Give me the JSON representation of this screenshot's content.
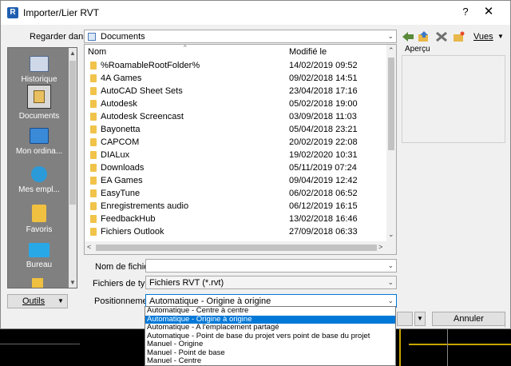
{
  "window": {
    "title": "Importer/Lier RVT",
    "help": "?",
    "close": "✕",
    "app_icon_letter": "R"
  },
  "look_in": {
    "label": "Regarder dans:",
    "value": "Documents"
  },
  "toolbar": {
    "views_label": "Vues"
  },
  "places": [
    {
      "label": "Historique",
      "icon": "history-icon"
    },
    {
      "label": "Documents",
      "icon": "documents-icon"
    },
    {
      "label": "Mon ordina...",
      "icon": "computer-icon"
    },
    {
      "label": "Mes empl...",
      "icon": "network-icon"
    },
    {
      "label": "Favoris",
      "icon": "favorites-icon"
    },
    {
      "label": "Bureau",
      "icon": "desktop-icon"
    }
  ],
  "file_list": {
    "col_name": "Nom",
    "col_modified": "Modifié le",
    "rows": [
      {
        "name": "%RoamableRootFolder%",
        "date": "14/02/2019 09:52"
      },
      {
        "name": "4A Games",
        "date": "09/02/2018 14:51"
      },
      {
        "name": "AutoCAD Sheet Sets",
        "date": "23/04/2018 17:16"
      },
      {
        "name": "Autodesk",
        "date": "05/02/2018 19:00"
      },
      {
        "name": "Autodesk Screencast",
        "date": "03/09/2018 11:03"
      },
      {
        "name": "Bayonetta",
        "date": "05/04/2018 23:21"
      },
      {
        "name": "CAPCOM",
        "date": "20/02/2019 22:08"
      },
      {
        "name": "DIALux",
        "date": "19/02/2020 10:31"
      },
      {
        "name": "Downloads",
        "date": "05/11/2019 07:24"
      },
      {
        "name": "EA Games",
        "date": "09/04/2019 12:42"
      },
      {
        "name": "EasyTune",
        "date": "06/02/2018 06:52"
      },
      {
        "name": "Enregistrements audio",
        "date": "06/12/2019 16:15"
      },
      {
        "name": "FeedbackHub",
        "date": "13/02/2018 16:46"
      },
      {
        "name": "Fichiers Outlook",
        "date": "27/09/2018 06:33"
      }
    ]
  },
  "preview": {
    "label": "Aperçu"
  },
  "filename": {
    "label": "Nom de fichier:",
    "value": ""
  },
  "filetype": {
    "label": "Fichiers de type:",
    "value": "Fichiers RVT  (*.rvt)"
  },
  "positioning": {
    "label": "Positionnement:",
    "value": "Automatique - Origine à origine",
    "options": [
      "Automatique - Centre à centre",
      "Automatique - Origine à origine",
      "Automatique - A l'emplacement partagé",
      "Automatique - Point de base du projet vers point de base du projet",
      "Manuel - Origine",
      "Manuel - Point de base",
      "Manuel - Centre"
    ],
    "selected_index": 1
  },
  "buttons": {
    "tools": "Outils",
    "cancel": "Annuler"
  },
  "colors": {
    "selection": "#0078d7",
    "places_bg": "#808080",
    "folder": "#f1c34a"
  }
}
